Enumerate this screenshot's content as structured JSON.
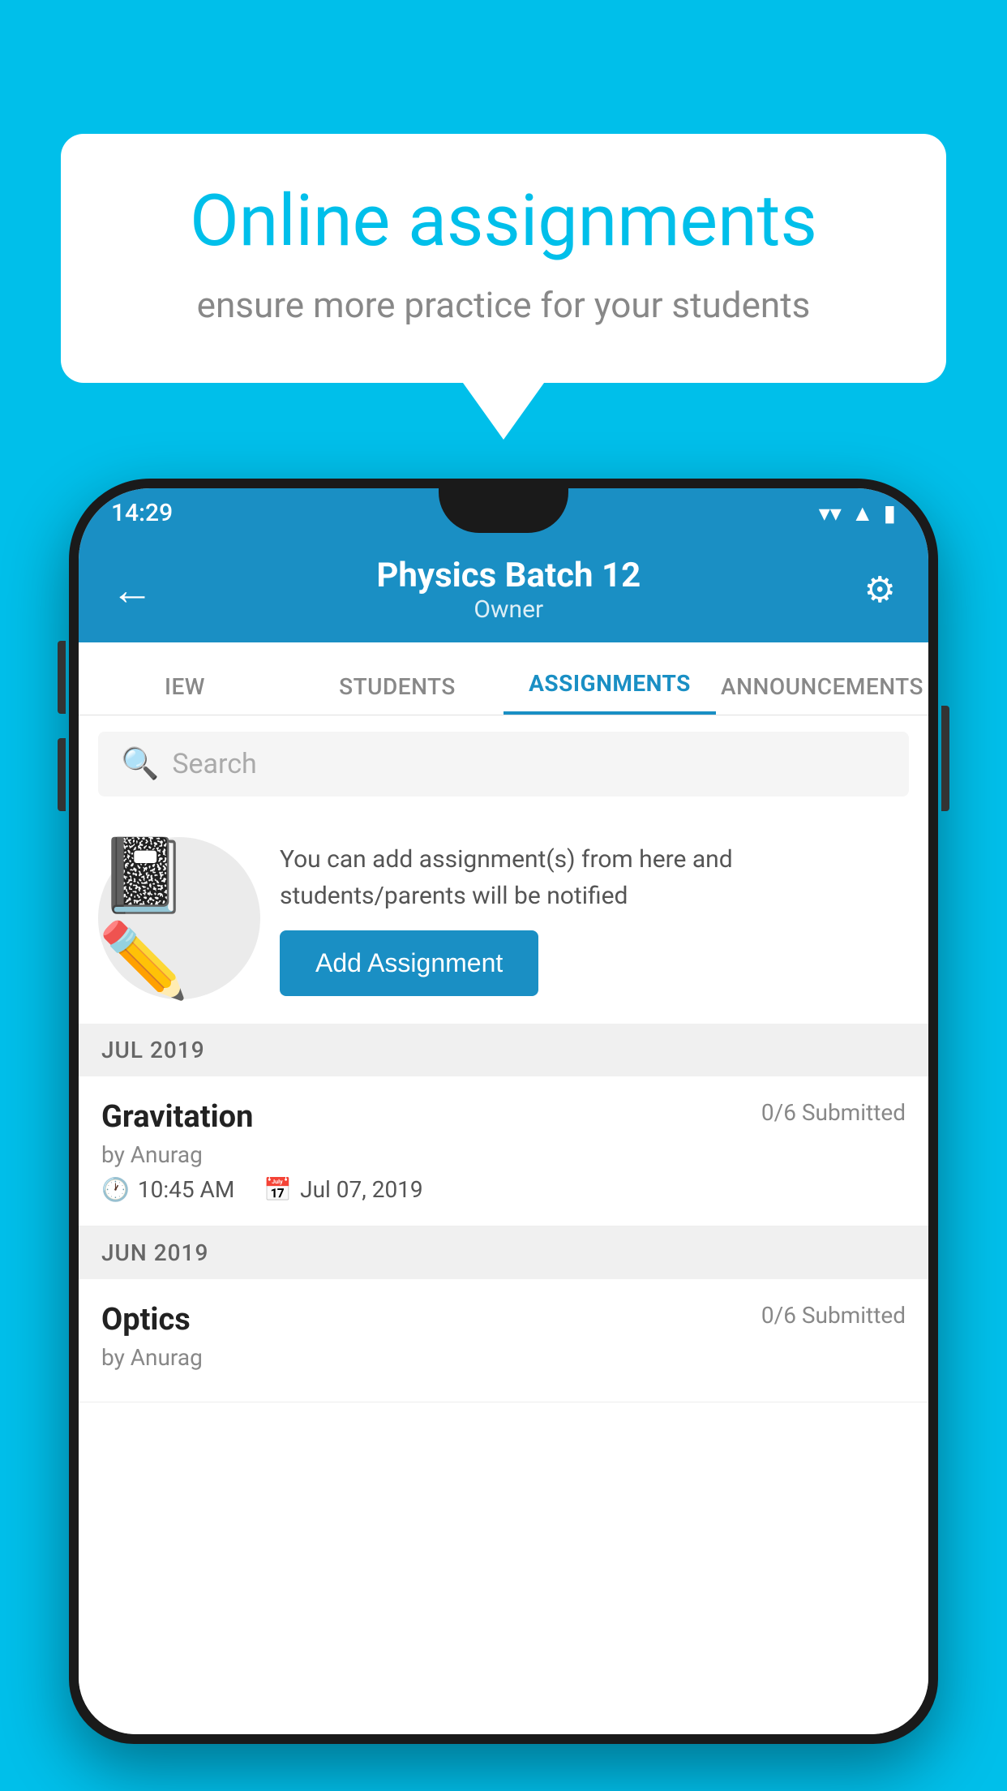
{
  "background": {
    "color": "#00BFEA"
  },
  "speech_bubble": {
    "title": "Online assignments",
    "subtitle": "ensure more practice for your students"
  },
  "phone": {
    "status_bar": {
      "time": "14:29",
      "wifi_icon": "▼",
      "signal_icon": "◀",
      "battery_icon": "▮"
    },
    "header": {
      "back_label": "←",
      "title": "Physics Batch 12",
      "subtitle": "Owner",
      "settings_icon": "⚙"
    },
    "tabs": [
      {
        "label": "IEW",
        "active": false
      },
      {
        "label": "STUDENTS",
        "active": false
      },
      {
        "label": "ASSIGNMENTS",
        "active": true
      },
      {
        "label": "ANNOUNCEMENTS",
        "active": false
      }
    ],
    "search": {
      "placeholder": "Search"
    },
    "promo": {
      "text": "You can add assignment(s) from here and students/parents will be notified",
      "button_label": "Add Assignment"
    },
    "sections": [
      {
        "header": "JUL 2019",
        "assignments": [
          {
            "name": "Gravitation",
            "submitted": "0/6 Submitted",
            "author": "by Anurag",
            "time": "10:45 AM",
            "date": "Jul 07, 2019"
          }
        ]
      },
      {
        "header": "JUN 2019",
        "assignments": [
          {
            "name": "Optics",
            "submitted": "0/6 Submitted",
            "author": "by Anurag",
            "time": "",
            "date": ""
          }
        ]
      }
    ]
  }
}
